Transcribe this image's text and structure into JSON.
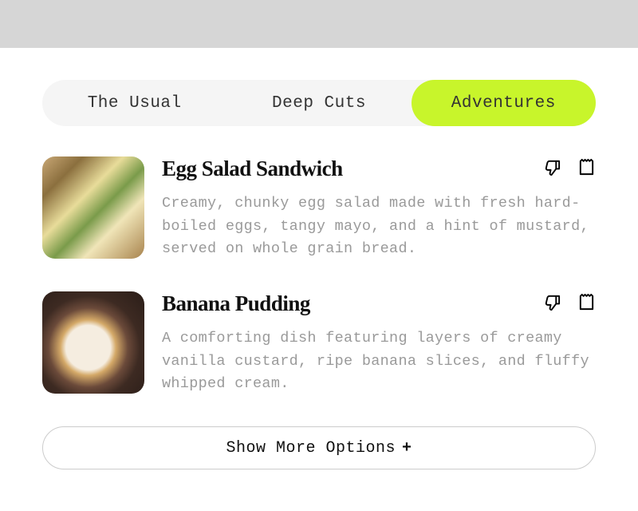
{
  "tabs": [
    {
      "label": "The Usual",
      "active": false
    },
    {
      "label": "Deep Cuts",
      "active": false
    },
    {
      "label": "Adventures",
      "active": true
    }
  ],
  "items": [
    {
      "title": "Egg Salad Sandwich",
      "description": "Creamy, chunky egg salad made with fresh hard-boiled eggs, tangy mayo, and a hint of mustard, served on whole grain bread.",
      "image": "sandwich"
    },
    {
      "title": "Banana Pudding",
      "description": "A comforting dish featuring layers of creamy vanilla custard, ripe banana slices, and fluffy whipped cream.",
      "image": "pudding"
    }
  ],
  "showMore": {
    "label": "Show More Options"
  },
  "colors": {
    "accent": "#c8f52b",
    "tabBg": "#f5f5f5",
    "descText": "#9a9a9a",
    "border": "#ccc"
  }
}
